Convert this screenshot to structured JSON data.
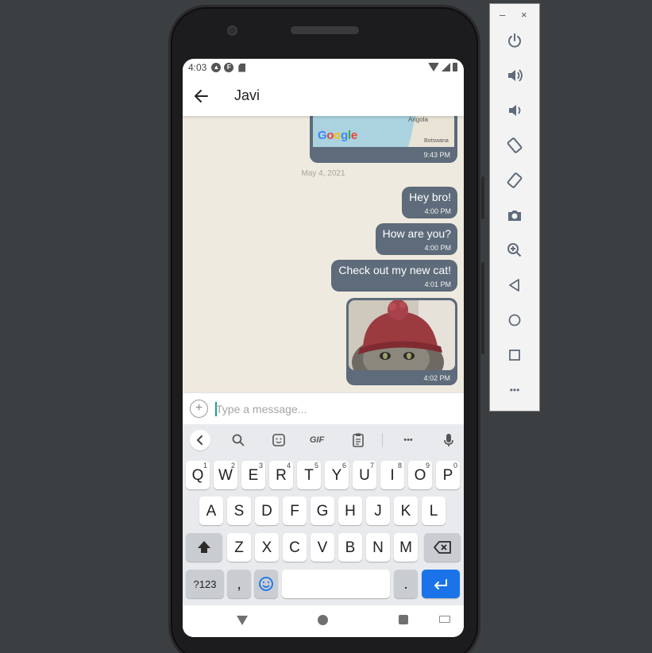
{
  "status_bar": {
    "time": "4:03"
  },
  "app_bar": {
    "title": "Javi"
  },
  "messages": {
    "map": {
      "brand": "Google",
      "label_angola": "Angola",
      "label_botswana": "Botswana",
      "time": "9:43 PM"
    },
    "date_separator": "May 4, 2021",
    "items": [
      {
        "text": "Hey bro!",
        "time": "4:00 PM"
      },
      {
        "text": "How are you?",
        "time": "4:00 PM"
      },
      {
        "text": "Check out my new cat!",
        "time": "4:01 PM"
      }
    ],
    "image": {
      "time": "4:02 PM"
    }
  },
  "composer": {
    "placeholder": "Type a message..."
  },
  "keyboard": {
    "toolbar": {
      "gif": "GIF",
      "more": "•••"
    },
    "row1": [
      {
        "k": "Q",
        "h": "1"
      },
      {
        "k": "W",
        "h": "2"
      },
      {
        "k": "E",
        "h": "3"
      },
      {
        "k": "R",
        "h": "4"
      },
      {
        "k": "T",
        "h": "5"
      },
      {
        "k": "Y",
        "h": "6"
      },
      {
        "k": "U",
        "h": "7"
      },
      {
        "k": "I",
        "h": "8"
      },
      {
        "k": "O",
        "h": "9"
      },
      {
        "k": "P",
        "h": "0"
      }
    ],
    "row2": [
      "A",
      "S",
      "D",
      "F",
      "G",
      "H",
      "J",
      "K",
      "L"
    ],
    "row3": [
      "Z",
      "X",
      "C",
      "V",
      "B",
      "N",
      "M"
    ],
    "symbols": "?123",
    "comma": ",",
    "period": "."
  },
  "emulator": {
    "minimize": "–",
    "close": "×",
    "more": "•••"
  },
  "colors": {
    "bubble": "#5d6b7a",
    "chat_bg": "#efeadf",
    "enter_key": "#1a73e8",
    "keyboard_bg": "#e8eaed"
  }
}
